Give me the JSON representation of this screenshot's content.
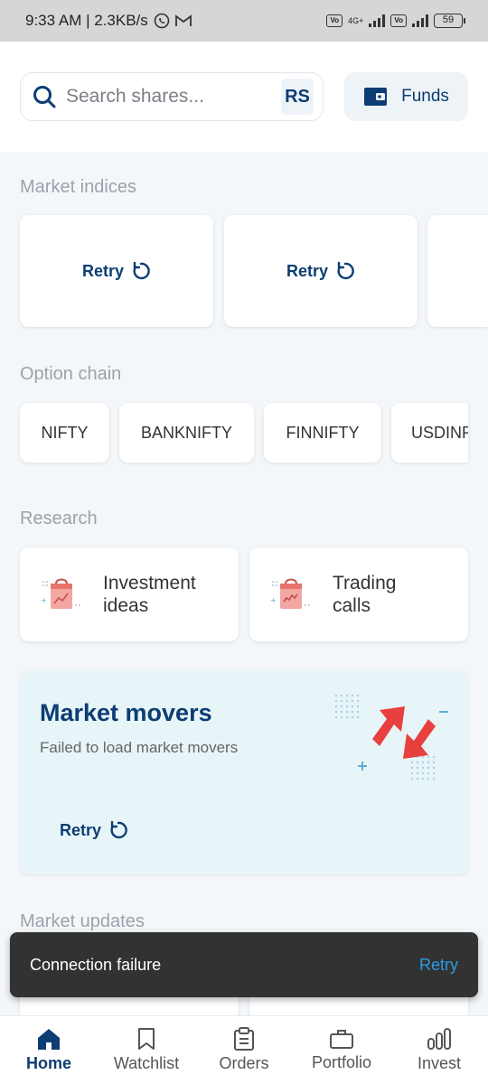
{
  "status_bar": {
    "time_speed": "9:33 AM | 2.3KB/s",
    "network_4g": "4G+",
    "battery": "59"
  },
  "search": {
    "placeholder": "Search shares...",
    "avatar_initials": "RS"
  },
  "funds_label": "Funds",
  "sections": {
    "market_indices": "Market indices",
    "option_chain": "Option chain",
    "research": "Research",
    "market_updates": "Market updates"
  },
  "indices": {
    "retry_label": "Retry"
  },
  "option_chain": [
    "NIFTY",
    "BANKNIFTY",
    "FINNIFTY",
    "USDINR"
  ],
  "research": [
    {
      "line1": "Investment",
      "line2": "ideas"
    },
    {
      "line1": "Trading",
      "line2": "calls"
    }
  ],
  "market_movers": {
    "title": "Market movers",
    "subtitle": "Failed to load market movers",
    "retry_label": "Retry"
  },
  "toast": {
    "message": "Connection failure",
    "action": "Retry"
  },
  "nav": [
    {
      "label": "Home",
      "icon": "home-icon",
      "active": true
    },
    {
      "label": "Watchlist",
      "icon": "bookmark-icon",
      "active": false
    },
    {
      "label": "Orders",
      "icon": "clipboard-icon",
      "active": false
    },
    {
      "label": "Portfolio",
      "icon": "briefcase-icon",
      "active": false
    },
    {
      "label": "Invest",
      "icon": "bar-chart-icon",
      "active": false
    }
  ],
  "colors": {
    "primary": "#0c3d73",
    "toast_action": "#2d9be6",
    "movers_bg": "#e8f5f8",
    "arrow_red": "#e8403f"
  }
}
